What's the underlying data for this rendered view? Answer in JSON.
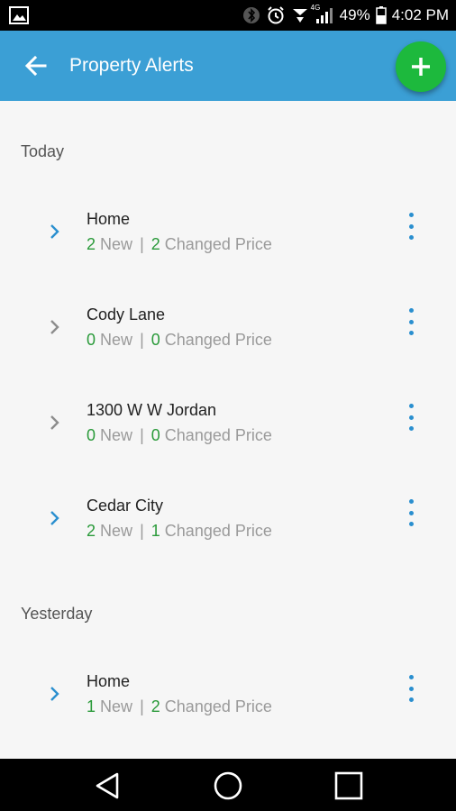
{
  "status_bar": {
    "network": "4G",
    "battery_percent": "49%",
    "time": "4:02 PM",
    "icons": [
      "image-icon",
      "bluetooth-icon",
      "alarm-icon",
      "wifi-icon",
      "signal-icon",
      "battery-icon"
    ]
  },
  "app_bar": {
    "title": "Property Alerts",
    "back_icon": "arrow-left-icon",
    "fab_icon": "plus-icon",
    "color": "#3b9fd5",
    "fab_color": "#1db93d"
  },
  "sections": [
    {
      "header": "Today",
      "items": [
        {
          "name": "Home",
          "new_count": "2",
          "new_label": "New",
          "changed_count": "2",
          "changed_label": "Changed Price",
          "chevron_color": "#2a8fcf"
        },
        {
          "name": "Cody Lane",
          "new_count": "0",
          "new_label": "New",
          "changed_count": "0",
          "changed_label": "Changed Price",
          "chevron_color": "#8c8c8c"
        },
        {
          "name": "1300 W W Jordan",
          "new_count": "0",
          "new_label": "New",
          "changed_count": "0",
          "changed_label": "Changed Price",
          "chevron_color": "#8c8c8c"
        },
        {
          "name": "Cedar City",
          "new_count": "2",
          "new_label": "New",
          "changed_count": "1",
          "changed_label": "Changed Price",
          "chevron_color": "#2a8fcf"
        }
      ]
    },
    {
      "header": "Yesterday",
      "items": [
        {
          "name": "Home",
          "new_count": "1",
          "new_label": "New",
          "changed_count": "2",
          "changed_label": "Changed Price",
          "chevron_color": "#2a8fcf"
        }
      ]
    }
  ],
  "separator": "|",
  "nav_bar": {
    "icons": [
      "back-triangle-icon",
      "home-circle-icon",
      "recents-square-icon"
    ]
  }
}
